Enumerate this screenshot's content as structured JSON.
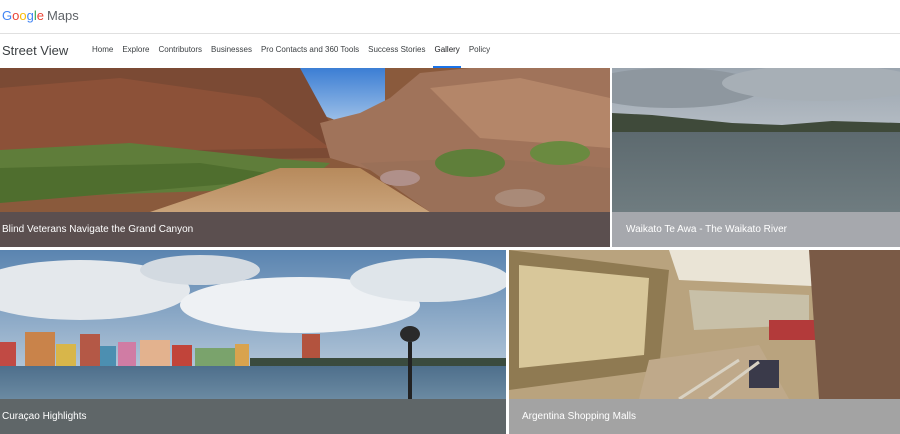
{
  "header": {
    "logo_letters": [
      "G",
      "o",
      "o",
      "g",
      "l",
      "e"
    ],
    "product": "Maps"
  },
  "nav": {
    "section_title": "Street View",
    "items": [
      {
        "label": "Home"
      },
      {
        "label": "Explore"
      },
      {
        "label": "Contributors"
      },
      {
        "label": "Businesses"
      },
      {
        "label": "Pro Contacts and 360 Tools"
      },
      {
        "label": "Success Stories"
      },
      {
        "label": "Gallery",
        "active": true
      },
      {
        "label": "Policy"
      }
    ]
  },
  "gallery": {
    "tiles": [
      {
        "title": "Blind Veterans Navigate the Grand Canyon",
        "caption_color": "#5b4f4f"
      },
      {
        "title": "Waikato Te Awa - The Waikato River",
        "caption_color": "#a6a8ad"
      },
      {
        "title": "Curaçao Highlights",
        "caption_color": "#5f6668"
      },
      {
        "title": "Argentina Shopping Malls",
        "caption_color": "#a3a3a3"
      }
    ]
  },
  "colors": {
    "active_tab_underline": "#1a73e8",
    "google_blue": "#4285f4",
    "google_red": "#ea4335",
    "google_yellow": "#fbbc05",
    "google_green": "#34a853"
  }
}
